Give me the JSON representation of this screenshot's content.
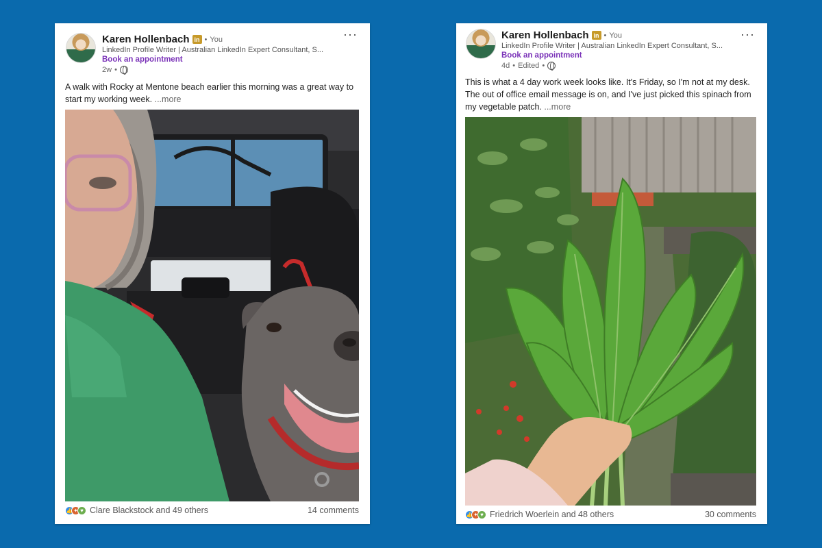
{
  "colors": {
    "background": "#0a6aad",
    "link_purple": "#7a32b8",
    "badge_gold": "#c79a2a"
  },
  "posts": [
    {
      "author": "Karen Hollenbach",
      "badge": "in",
      "relation": "You",
      "headline": "LinkedIn Profile Writer | Australian LinkedIn Expert Consultant, S...",
      "cta": "Book an appointment",
      "age": "2w",
      "text": "A walk with Rocky at Mentone beach earlier this morning was a great way to start my working week.",
      "see_more": "...more",
      "reactions_text": "Clare Blackstock and 49 others",
      "comments": "14 comments",
      "icons": [
        "like-icon",
        "celebrate-icon",
        "support-icon",
        "globe-icon",
        "more-icon"
      ]
    },
    {
      "author": "Karen Hollenbach",
      "badge": "in",
      "relation": "You",
      "headline": "LinkedIn Profile Writer | Australian LinkedIn Expert Consultant, S...",
      "cta": "Book an appointment",
      "age": "4d",
      "edited": "Edited",
      "text": "This is what a 4 day work week looks like. It's Friday, so I'm not at my desk. The out of office email message is on, and I've just picked this spinach from my vegetable patch.",
      "see_more": "...more",
      "reactions_text": "Friedrich Woerlein and 48 others",
      "comments": "30 comments",
      "icons": [
        "like-icon",
        "celebrate-icon",
        "support-icon",
        "globe-icon",
        "more-icon"
      ]
    }
  ]
}
